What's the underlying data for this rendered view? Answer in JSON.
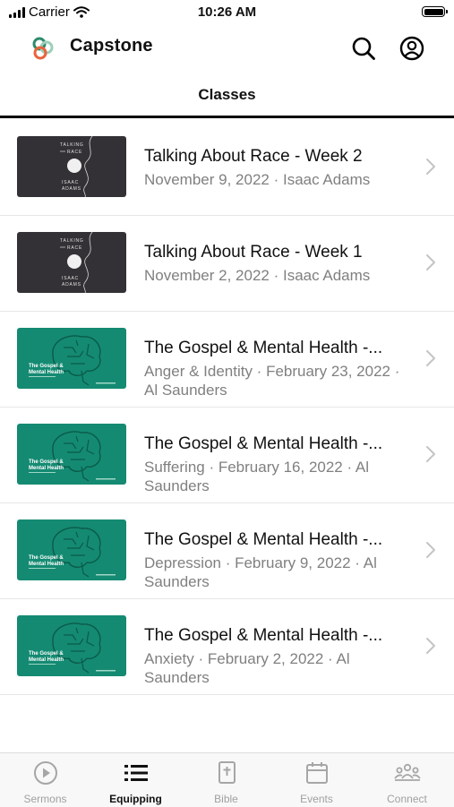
{
  "status_bar": {
    "carrier": "Carrier",
    "time": "10:26 AM"
  },
  "header": {
    "title": "Classes",
    "app_name": "Capstone",
    "search_icon": "search-icon",
    "account_icon": "account-icon"
  },
  "classes": [
    {
      "title": "Talking About Race - Week 2",
      "subtitle": "November 9, 2022 · Isaac Adams",
      "thumb": "talking-about-race"
    },
    {
      "title": "Talking About Race - Week 1",
      "subtitle": "November 2, 2022 · Isaac Adams",
      "thumb": "talking-about-race"
    },
    {
      "title": "The Gospel & Mental Health -...",
      "subtitle": "Anger & Identity · February 23, 2022 · Al Saunders",
      "thumb": "gospel-mental-health"
    },
    {
      "title": "The Gospel & Mental Health -...",
      "subtitle": "Suffering · February 16, 2022 · Al Saunders",
      "thumb": "gospel-mental-health"
    },
    {
      "title": "The Gospel & Mental Health -...",
      "subtitle": "Depression · February 9, 2022 · Al Saunders",
      "thumb": "gospel-mental-health"
    },
    {
      "title": "The Gospel & Mental Health -...",
      "subtitle": "Anxiety · February 2, 2022 · Al Saunders",
      "thumb": "gospel-mental-health"
    }
  ],
  "thumbnails": {
    "race": {
      "line1": "TALKING",
      "line2": "RACE",
      "line3": "ISAAC",
      "line4": "ADAMS"
    },
    "gospel": {
      "line1": "The Gospel &",
      "line2": "Mental Health"
    }
  },
  "tab_bar": [
    {
      "label": "Sermons",
      "icon": "play-circle-icon",
      "active": false
    },
    {
      "label": "Equipping",
      "icon": "list-icon",
      "active": true
    },
    {
      "label": "Bible",
      "icon": "bible-icon",
      "active": false
    },
    {
      "label": "Events",
      "icon": "calendar-icon",
      "active": false
    },
    {
      "label": "Connect",
      "icon": "people-icon",
      "active": false
    }
  ],
  "colors": {
    "thumb_dark": "#333135",
    "thumb_green": "#148a72",
    "logo_green": "#2e8b6e",
    "logo_orange": "#e8643c"
  }
}
